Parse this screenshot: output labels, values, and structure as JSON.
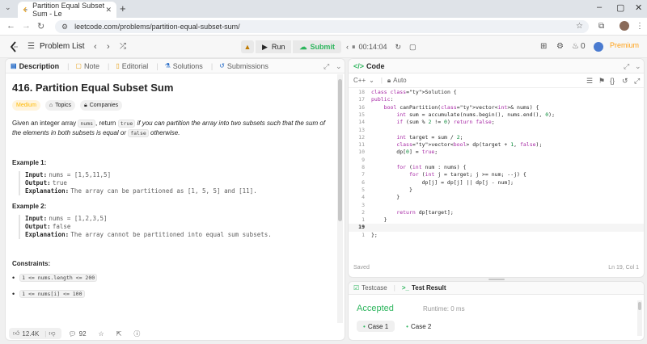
{
  "browser": {
    "tab_title": "Partition Equal Subset Sum - Le",
    "tab_close": "✕",
    "new_tab": "+",
    "url": "leetcode.com/problems/partition-equal-subset-sum/"
  },
  "header": {
    "problem_list": "Problem List",
    "run_label": "Run",
    "submit_label": "Submit",
    "timer": "00:14:04",
    "coins": "0",
    "premium": "Premium"
  },
  "left_tabs": [
    {
      "label": "Description",
      "icon": "description-icon"
    },
    {
      "label": "Note",
      "icon": "note-icon"
    },
    {
      "label": "Editorial",
      "icon": "editorial-icon"
    },
    {
      "label": "Solutions",
      "icon": "flask-icon"
    },
    {
      "label": "Submissions",
      "icon": "history-icon"
    }
  ],
  "problem": {
    "title": "416. Partition Equal Subset Sum",
    "difficulty": "Medium",
    "topics": "Topics",
    "companies": "Companies",
    "stmt_1": "Given an integer array ",
    "stmt_code_1": "nums",
    "stmt_2": ", return ",
    "stmt_code_2": "true",
    "stmt_3": " if you can partition the array into two subsets such that the sum of the elements in both subsets is equal or ",
    "stmt_code_3": "false",
    "stmt_4": " otherwise.",
    "examples": [
      {
        "heading": "Example 1:",
        "input_label": "Input:",
        "input": "nums = [1,5,11,5]",
        "output_label": "Output:",
        "output": "true",
        "explanation_label": "Explanation:",
        "explanation": "The array can be partitioned as [1, 5, 5] and [11]."
      },
      {
        "heading": "Example 2:",
        "input_label": "Input:",
        "input": "nums = [1,2,3,5]",
        "output_label": "Output:",
        "output": "false",
        "explanation_label": "Explanation:",
        "explanation": "The array cannot be partitioned into equal sum subsets."
      }
    ],
    "constraints_heading": "Constraints:",
    "constraints": [
      "1 <= nums.length <= 200",
      "1 <= nums[i] <= 100"
    ]
  },
  "footer": {
    "likes": "12.4K",
    "comments": "92"
  },
  "code_panel": {
    "title": "Code",
    "language": "C++",
    "autocomplete": "Auto",
    "saved": "Saved",
    "cursor": "Ln 19, Col 1",
    "lines": [
      {
        "n": "18",
        "t": "class Solution {"
      },
      {
        "n": "17",
        "t": "public:"
      },
      {
        "n": "16",
        "t": "    bool canPartition(vector<int>& nums) {"
      },
      {
        "n": "15",
        "t": "        int sum = accumulate(nums.begin(), nums.end(), 0);"
      },
      {
        "n": "14",
        "t": "        if (sum % 2 != 0) return false;"
      },
      {
        "n": "13",
        "t": ""
      },
      {
        "n": "12",
        "t": "        int target = sum / 2;"
      },
      {
        "n": "11",
        "t": "        vector<bool> dp(target + 1, false);"
      },
      {
        "n": "10",
        "t": "        dp[0] = true;"
      },
      {
        "n": "9",
        "t": ""
      },
      {
        "n": "8",
        "t": "        for (int num : nums) {"
      },
      {
        "n": "7",
        "t": "            for (int j = target; j >= num; --j) {"
      },
      {
        "n": "6",
        "t": "                dp[j] = dp[j] || dp[j - num];"
      },
      {
        "n": "5",
        "t": "            }"
      },
      {
        "n": "4",
        "t": "        }"
      },
      {
        "n": "3",
        "t": ""
      },
      {
        "n": "2",
        "t": "        return dp[target];"
      },
      {
        "n": "1",
        "t": "    }"
      },
      {
        "n": "19",
        "t": ""
      },
      {
        "n": "1",
        "t": "};"
      }
    ]
  },
  "test_panel": {
    "testcase_tab": "Testcase",
    "result_tab": "Test Result",
    "status": "Accepted",
    "runtime": "Runtime: 0 ms",
    "cases": [
      "Case 1",
      "Case 2"
    ]
  },
  "colors": {
    "accepted": "#2db55d",
    "medium": "#ffb800",
    "premium": "#ffa116"
  }
}
